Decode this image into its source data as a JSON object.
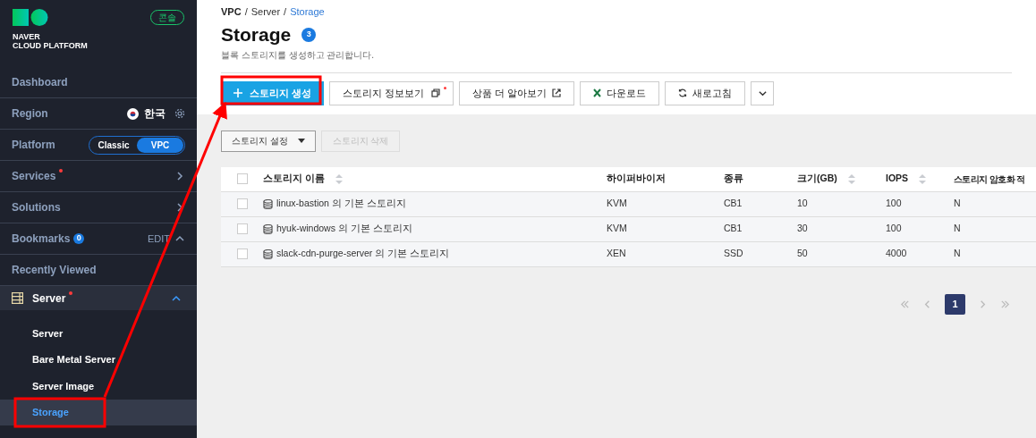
{
  "sidebar": {
    "logo": {
      "line_1": "NAVER",
      "line_2": "CLOUD PLATFORM"
    },
    "console_badge": "콘솔",
    "rows": [
      {
        "kind": "plain",
        "label": "Dashboard"
      },
      {
        "kind": "region",
        "label": "Region",
        "value": "한국"
      },
      {
        "kind": "platform",
        "label": "Platform",
        "options": [
          {
            "label": "Classic",
            "selected": false
          },
          {
            "label": "VPC",
            "selected": true
          }
        ]
      },
      {
        "kind": "link",
        "label": "Services",
        "new": true
      },
      {
        "kind": "link",
        "label": "Solutions",
        "new": false
      },
      {
        "kind": "bookmarks",
        "label": "Bookmarks",
        "count": "0",
        "action": "EDIT"
      },
      {
        "kind": "plain",
        "label": "Recently Viewed"
      }
    ],
    "group": {
      "label": "Server",
      "new": true,
      "expanded": true,
      "children": [
        {
          "label": "Server",
          "selected": false
        },
        {
          "label": "Bare Metal Server",
          "selected": false
        },
        {
          "label": "Server Image",
          "selected": false
        },
        {
          "label": "Storage",
          "selected": true
        }
      ]
    }
  },
  "breadcrumb": [
    {
      "label": "VPC",
      "separator": "/"
    },
    {
      "label": "Server",
      "separator": "/"
    },
    {
      "label": "Storage"
    }
  ],
  "title": "Storage",
  "count": "3",
  "description": "블록 스토리지를 생성하고 관리합니다.",
  "toolbar": [
    {
      "kind": "primary",
      "label": "스토리지 생성"
    },
    {
      "kind": "window",
      "label": "스토리지 정보보기",
      "new": true
    },
    {
      "kind": "external",
      "label": "상품 더 알아보기"
    },
    {
      "kind": "excel",
      "label": "다운로드"
    },
    {
      "kind": "refresh",
      "label": "새로고침"
    },
    {
      "kind": "more"
    }
  ],
  "actions": [
    {
      "label": "스토리지 설정",
      "disabled": false
    },
    {
      "label": "스토리지 삭제",
      "disabled": true
    }
  ],
  "table": {
    "all_checked": false,
    "columns": [
      {
        "label": "스토리지 이름",
        "sortable": true
      },
      {
        "label": "하이퍼바이저",
        "sortable": false
      },
      {
        "label": "종류",
        "sortable": false
      },
      {
        "label": "크기(GB)",
        "sortable": true
      },
      {
        "label": "IOPS",
        "sortable": true
      },
      {
        "label": "스토리지 암호화 적"
      }
    ],
    "rows": [
      {
        "checked": false,
        "cells": [
          "linux-bastion 의 기본 스토리지",
          "KVM",
          "CB1",
          "10",
          "100",
          "N"
        ]
      },
      {
        "checked": false,
        "cells": [
          "hyuk-windows 의 기본 스토리지",
          "KVM",
          "CB1",
          "30",
          "100",
          "N"
        ]
      },
      {
        "checked": false,
        "cells": [
          "slack-cdn-purge-server 의 기본 스토리지",
          "XEN",
          "SSD",
          "50",
          "4000",
          "N"
        ]
      }
    ]
  },
  "pagination": {
    "pages": [
      {
        "label": "1",
        "selected": true
      }
    ]
  }
}
